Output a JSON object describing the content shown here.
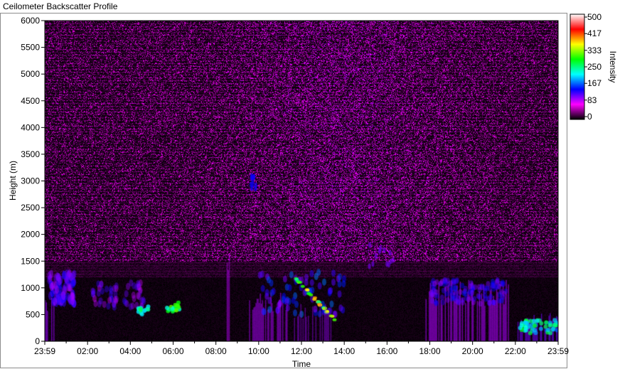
{
  "window": {
    "title": "Ceilometer Backscatter Profile"
  },
  "chart_data": {
    "type": "heatmap",
    "title": "",
    "xlabel": "Time",
    "ylabel": "Height (m)",
    "colorbar_label": "Intensity",
    "ylim": [
      0,
      6000
    ],
    "xlim": [
      "23:59",
      "23:59"
    ],
    "x_ticks": [
      "23:59",
      "02:00",
      "04:00",
      "06:00",
      "08:00",
      "10:00",
      "12:00",
      "14:00",
      "16:00",
      "18:00",
      "20:00",
      "22:00",
      "23:59"
    ],
    "y_ticks": [
      0,
      500,
      1000,
      1500,
      2000,
      2500,
      3000,
      3500,
      4000,
      4500,
      5000,
      5500,
      6000
    ],
    "color_scale": {
      "min": 0,
      "max": 500,
      "ticks": [
        0,
        83,
        167,
        250,
        333,
        417,
        500
      ],
      "colors": [
        "#000000",
        "#ff00ff",
        "#0000ff",
        "#00ffff",
        "#00ff00",
        "#ffff00",
        "#ff0000",
        "#ffffff"
      ]
    },
    "grid": false,
    "background_level": 30
  }
}
